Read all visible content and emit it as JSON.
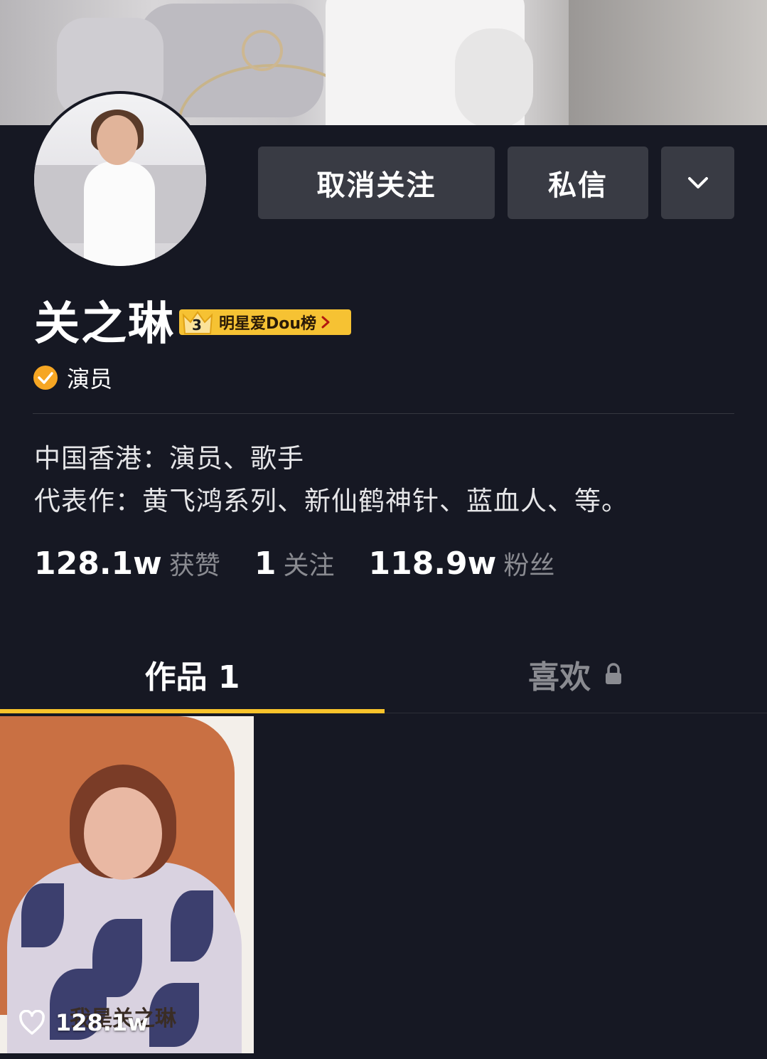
{
  "profile": {
    "name": "关之琳",
    "rank_badge": {
      "rank": "3",
      "label": "明星爱Dou榜"
    },
    "verification": "演员",
    "bio_lines": [
      "中国香港：演员、歌手",
      "代表作：黄飞鸿系列、新仙鹤神针、蓝血人、等。"
    ]
  },
  "actions": {
    "unfollow_label": "取消关注",
    "message_label": "私信",
    "more_icon": "chevron-down-icon"
  },
  "stats": [
    {
      "value": "128.1w",
      "label": "获赞"
    },
    {
      "value": "1",
      "label": "关注"
    },
    {
      "value": "118.9w",
      "label": "粉丝"
    }
  ],
  "tabs": [
    {
      "label": "作品 1",
      "active": true
    },
    {
      "label": "喜欢",
      "locked": true,
      "icon": "lock-icon"
    }
  ],
  "videos": [
    {
      "caption": "我是关之琳",
      "likes": "128.1w",
      "icon": "heart-icon"
    }
  ],
  "colors": {
    "background": "#161823",
    "button": "#393b44",
    "accent": "#f8c32b",
    "verify": "#f6a623",
    "muted_text": "#8a8b91"
  }
}
